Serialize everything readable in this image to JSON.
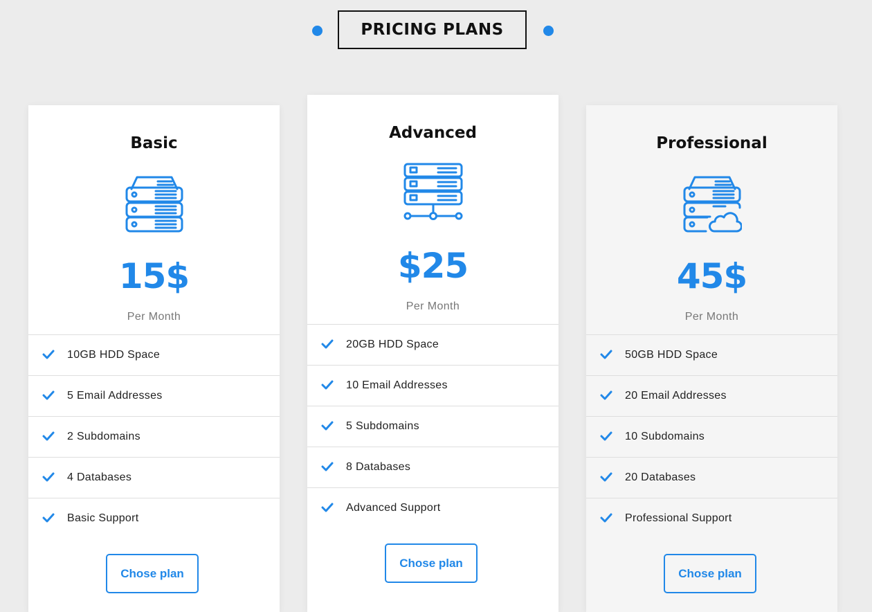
{
  "section": {
    "title": "PRICING PLANS",
    "accent_color": "#2188e8"
  },
  "plans": [
    {
      "name": "Basic",
      "icon": "server-stack-icon",
      "price": "15$",
      "period": "Per Month",
      "features": [
        "10GB HDD Space",
        "5 Email Addresses",
        "2 Subdomains",
        "4 Databases",
        "Basic Support"
      ],
      "button_label": "Chose plan"
    },
    {
      "name": "Advanced",
      "icon": "server-network-icon",
      "price": "$25",
      "period": "Per Month",
      "features": [
        "20GB HDD Space",
        "10 Email Addresses",
        "5 Subdomains",
        "8 Databases",
        "Advanced Support"
      ],
      "button_label": "Chose plan"
    },
    {
      "name": "Professional",
      "icon": "server-cloud-icon",
      "price": "45$",
      "period": "Per Month",
      "features": [
        "50GB HDD Space",
        "20 Email Addresses",
        "10 Subdomains",
        "20 Databases",
        "Professional Support"
      ],
      "button_label": "Chose plan"
    }
  ]
}
